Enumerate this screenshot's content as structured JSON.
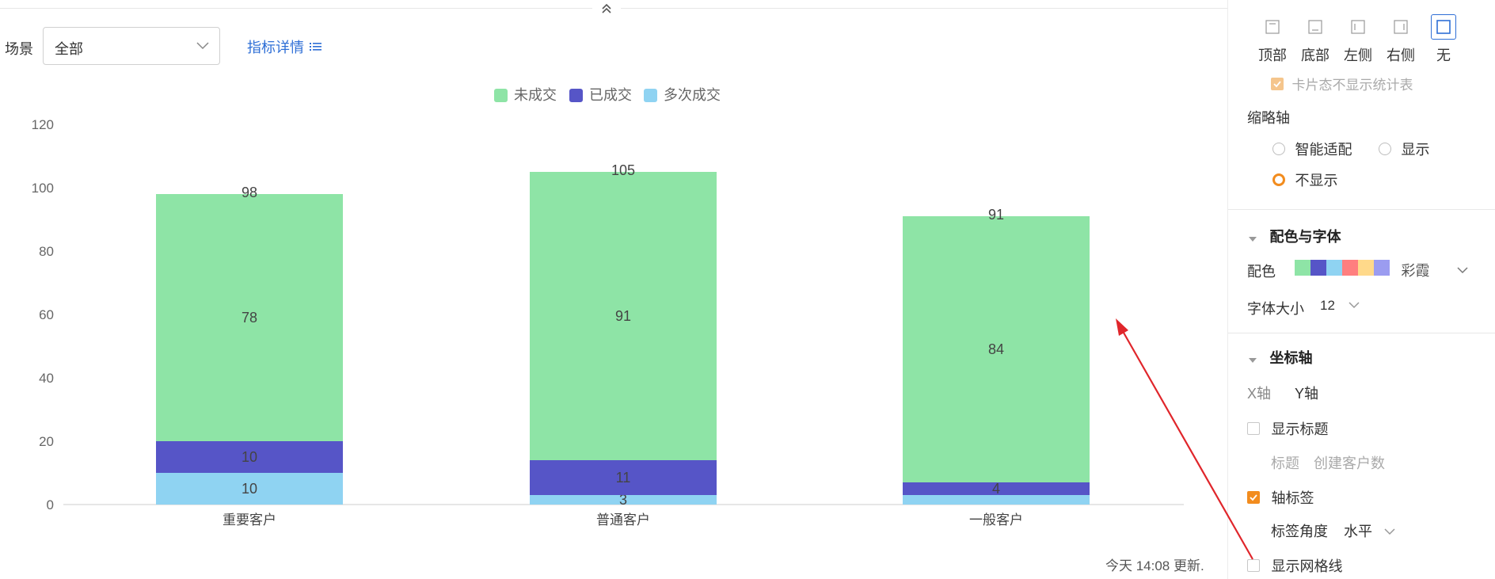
{
  "toolbar": {
    "scene_label": "场景",
    "scene_value": "全部",
    "metric_link": "指标详情"
  },
  "chart_data": {
    "type": "bar",
    "stacked": true,
    "categories": [
      "重要客户",
      "普通客户",
      "一般客户"
    ],
    "series": [
      {
        "name": "多次成交",
        "color": "#8fd3f2",
        "values": [
          10,
          3,
          3
        ],
        "labels": [
          "10",
          "3",
          ""
        ]
      },
      {
        "name": "已成交",
        "color": "#5655c7",
        "values": [
          10,
          11,
          4
        ],
        "labels": [
          "10",
          "11",
          "4"
        ]
      },
      {
        "name": "未成交",
        "color": "#8ee4a6",
        "values": [
          78,
          91,
          84
        ],
        "labels": [
          "78",
          "91",
          "84"
        ]
      }
    ],
    "legend_order": [
      "未成交",
      "已成交",
      "多次成交"
    ],
    "totals": [
      98,
      105,
      91
    ],
    "ylim": [
      0,
      120
    ],
    "yticks": [
      0,
      20,
      40,
      60,
      80,
      100,
      120
    ],
    "grid": false,
    "legend_position": "top-center"
  },
  "footer": {
    "update_text": "今天 14:08 更新."
  },
  "panel": {
    "legend_positions": [
      {
        "label": "顶部",
        "icon": "legend-top-icon",
        "active": false
      },
      {
        "label": "底部",
        "icon": "legend-bottom-icon",
        "active": false
      },
      {
        "label": "左侧",
        "icon": "legend-left-icon",
        "active": false
      },
      {
        "label": "右侧",
        "icon": "legend-right-icon",
        "active": false
      },
      {
        "label": "无",
        "icon": "legend-none-icon",
        "active": true
      }
    ],
    "card_hide_stats": "卡片态不显示统计表",
    "thumbnail_axis": {
      "title": "缩略轴",
      "opt_smart": "智能适配",
      "opt_show": "显示",
      "opt_hide": "不显示",
      "selected": "不显示"
    },
    "color_font": {
      "title": "配色与字体",
      "color_label": "配色",
      "palette": [
        "#8ee4a6",
        "#5655c7",
        "#8fd3f2",
        "#ff7f7f",
        "#ffd98a",
        "#9b9cf0"
      ],
      "palette_name": "彩霞",
      "font_size_label": "字体大小",
      "font_size_value": "12"
    },
    "axis": {
      "title": "坐标轴",
      "tab_x": "X轴",
      "tab_y": "Y轴",
      "show_title": "显示标题",
      "title_label": "标题",
      "title_value": "创建客户数",
      "axis_label": "轴标签",
      "label_angle": "标签角度",
      "label_angle_value": "水平",
      "show_grid": "显示网格线"
    }
  }
}
